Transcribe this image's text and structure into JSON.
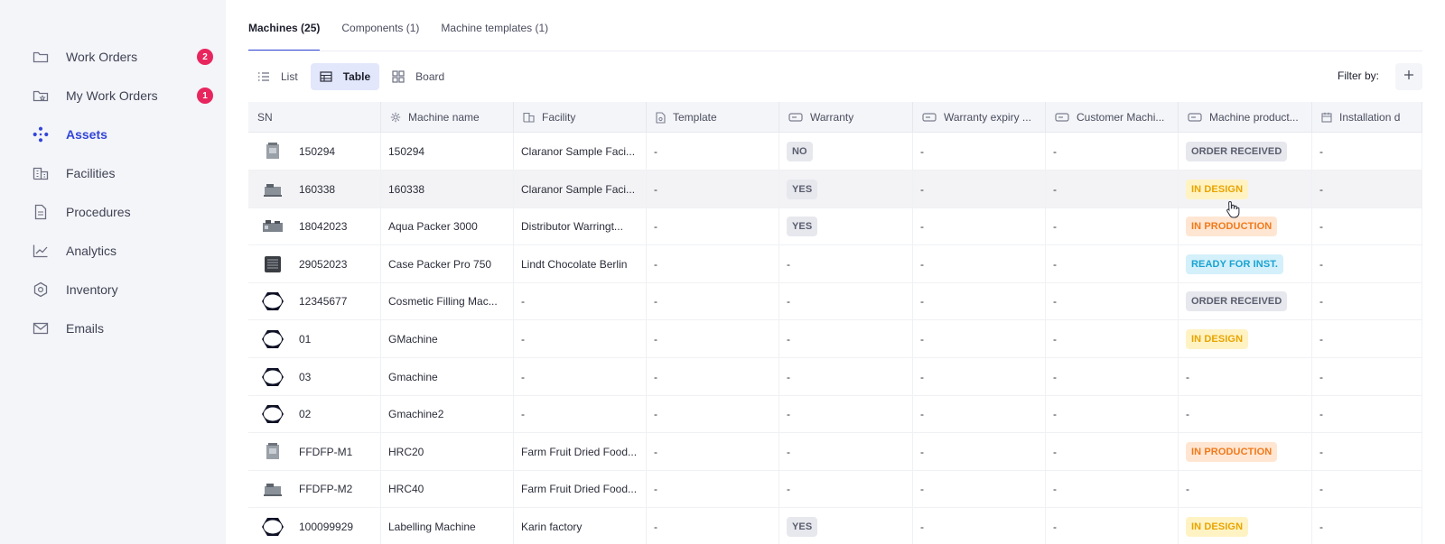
{
  "sidebar": {
    "items": [
      {
        "label": "Work Orders",
        "icon": "folder-icon",
        "badge": "2",
        "active": false
      },
      {
        "label": "My Work Orders",
        "icon": "folder-star-icon",
        "badge": "1",
        "active": false
      },
      {
        "label": "Assets",
        "icon": "assets-network-icon",
        "badge": "",
        "active": true
      },
      {
        "label": "Facilities",
        "icon": "building-icon",
        "badge": "",
        "active": false
      },
      {
        "label": "Procedures",
        "icon": "document-icon",
        "badge": "",
        "active": false
      },
      {
        "label": "Analytics",
        "icon": "line-chart-icon",
        "badge": "",
        "active": false
      },
      {
        "label": "Inventory",
        "icon": "hexagon-icon",
        "badge": "",
        "active": false
      },
      {
        "label": "Emails",
        "icon": "mail-icon",
        "badge": "",
        "active": false
      }
    ]
  },
  "tabs": [
    {
      "label": "Machines (25)",
      "active": true
    },
    {
      "label": "Components (1)",
      "active": false
    },
    {
      "label": "Machine templates (1)",
      "active": false
    }
  ],
  "views": [
    {
      "label": "List",
      "icon": "list-icon",
      "active": false
    },
    {
      "label": "Table",
      "icon": "table-icon",
      "active": true
    },
    {
      "label": "Board",
      "icon": "board-icon",
      "active": false
    }
  ],
  "filter": {
    "label": "Filter by:",
    "add_icon": "plus-icon"
  },
  "colors": {
    "accent": "#3345d8",
    "badge": "#e8265e",
    "sidebar_bg": "#f4f5f9"
  },
  "table": {
    "columns": [
      {
        "label": "SN",
        "icon": ""
      },
      {
        "label": "Machine name",
        "icon": "machine-gear-icon"
      },
      {
        "label": "Facility",
        "icon": "building-icon"
      },
      {
        "label": "Template",
        "icon": "template-icon"
      },
      {
        "label": "Warranty",
        "icon": "field-icon"
      },
      {
        "label": "Warranty expiry ...",
        "icon": "field-icon"
      },
      {
        "label": "Customer Machi...",
        "icon": "field-icon"
      },
      {
        "label": "Machine product...",
        "icon": "field-icon"
      },
      {
        "label": "Installation d",
        "icon": "calendar-icon"
      }
    ],
    "rows": [
      {
        "thumb": "machine-photo",
        "sn": "150294",
        "name": "150294",
        "facility": "Claranor Sample Faci...",
        "template": "-",
        "warranty": "NO",
        "warranty_expiry": "-",
        "customer_machine": "-",
        "status": "ORDER RECEIVED",
        "status_color": "grey",
        "installation": "-"
      },
      {
        "thumb": "machine-photo",
        "sn": "160338",
        "name": "160338",
        "facility": "Claranor Sample Faci...",
        "template": "-",
        "warranty": "YES",
        "warranty_expiry": "-",
        "customer_machine": "-",
        "status": "IN DESIGN",
        "status_color": "yellow",
        "installation": "-",
        "hover": true
      },
      {
        "thumb": "machine-photo",
        "sn": "18042023",
        "name": "Aqua Packer 3000",
        "facility": "Distributor Warringt...",
        "template": "-",
        "warranty": "YES",
        "warranty_expiry": "-",
        "customer_machine": "-",
        "status": "IN PRODUCTION",
        "status_color": "orange",
        "installation": "-"
      },
      {
        "thumb": "machine-photo",
        "sn": "29052023",
        "name": "Case Packer Pro 750",
        "facility": "Lindt Chocolate Berlin",
        "template": "-",
        "warranty": "-",
        "warranty_expiry": "-",
        "customer_machine": "-",
        "status": "READY FOR INST.",
        "status_color": "cyan",
        "installation": "-"
      },
      {
        "thumb": "placeholder",
        "sn": "12345677",
        "name": "Cosmetic Filling Mac...",
        "facility": "-",
        "template": "-",
        "warranty": "-",
        "warranty_expiry": "-",
        "customer_machine": "-",
        "status": "ORDER RECEIVED",
        "status_color": "grey",
        "installation": "-"
      },
      {
        "thumb": "placeholder",
        "sn": "01",
        "name": "GMachine",
        "facility": "-",
        "template": "-",
        "warranty": "-",
        "warranty_expiry": "-",
        "customer_machine": "-",
        "status": "IN DESIGN",
        "status_color": "yellow",
        "installation": "-"
      },
      {
        "thumb": "placeholder",
        "sn": "03",
        "name": "Gmachine",
        "facility": "-",
        "template": "-",
        "warranty": "-",
        "warranty_expiry": "-",
        "customer_machine": "-",
        "status": "-",
        "status_color": "",
        "installation": "-"
      },
      {
        "thumb": "placeholder",
        "sn": "02",
        "name": "Gmachine2",
        "facility": "-",
        "template": "-",
        "warranty": "-",
        "warranty_expiry": "-",
        "customer_machine": "-",
        "status": "-",
        "status_color": "",
        "installation": "-"
      },
      {
        "thumb": "machine-photo",
        "sn": "FFDFP-M1",
        "name": "HRC20",
        "facility": "Farm Fruit Dried Food...",
        "template": "-",
        "warranty": "-",
        "warranty_expiry": "-",
        "customer_machine": "-",
        "status": "IN PRODUCTION",
        "status_color": "orange",
        "installation": "-"
      },
      {
        "thumb": "machine-photo",
        "sn": "FFDFP-M2",
        "name": "HRC40",
        "facility": "Farm Fruit Dried Food...",
        "template": "-",
        "warranty": "-",
        "warranty_expiry": "-",
        "customer_machine": "-",
        "status": "-",
        "status_color": "",
        "installation": "-"
      },
      {
        "thumb": "placeholder",
        "sn": "100099929",
        "name": "Labelling Machine",
        "facility": "Karin factory",
        "template": "-",
        "warranty": "YES",
        "warranty_expiry": "-",
        "customer_machine": "-",
        "status": "IN DESIGN",
        "status_color": "yellow",
        "installation": "-"
      }
    ]
  },
  "cursor_icon": "hand-pointer-icon"
}
